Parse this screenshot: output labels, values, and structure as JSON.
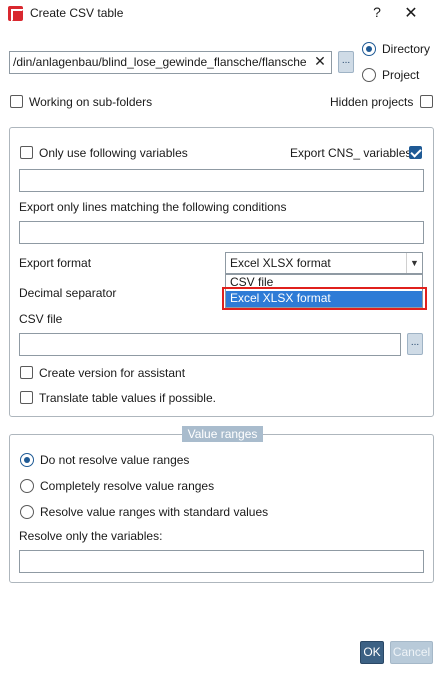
{
  "window": {
    "title": "Create CSV table",
    "help_label": "?",
    "close_label": "✕",
    "app_icon": "app-logo-icon"
  },
  "path_row": {
    "path_value": "/din/anlagenbau/blind_lose_gewinde_flansche/flansche",
    "clear_label": "✕",
    "browse_label": "...",
    "scope_options": [
      {
        "label": "Directory",
        "selected": true
      },
      {
        "label": "Project",
        "selected": false
      }
    ]
  },
  "options_top": {
    "working_on_subfolders": {
      "label": "Working on sub-folders",
      "checked": false
    },
    "hidden_projects": {
      "label": "Hidden projects",
      "checked": false
    }
  },
  "export_group": {
    "only_following_variables": {
      "label": "Only use following variables",
      "checked": false,
      "value": ""
    },
    "export_cns_variables": {
      "label": "Export CNS_ variables",
      "checked": true
    },
    "conditions_label": "Export only lines matching the following conditions",
    "conditions_value": "",
    "export_format_label": "Export format",
    "export_format_value": "Excel XLSX format",
    "export_format_options": [
      "CSV file",
      "Excel XLSX format"
    ],
    "export_format_highlighted": "Excel XLSX format",
    "decimal_separator_label": "Decimal separator",
    "csv_file_label": "CSV file",
    "csv_file_value": "",
    "csv_browse_label": "...",
    "create_version": {
      "label": "Create version for assistant",
      "checked": false
    },
    "translate_values": {
      "label": "Translate table values if possible.",
      "checked": false
    }
  },
  "value_ranges": {
    "legend": "Value ranges",
    "options": [
      {
        "label": "Do not resolve value ranges",
        "selected": true
      },
      {
        "label": "Completely resolve value ranges",
        "selected": false
      },
      {
        "label": "Resolve value ranges with standard values",
        "selected": false
      }
    ],
    "resolve_only_label": "Resolve only the variables:",
    "resolve_only_value": ""
  },
  "buttons": {
    "ok_label": "OK",
    "cancel_label": "Cancel"
  },
  "colors": {
    "accent": "#1f5a95",
    "selection": "#2e7bd6",
    "highlight_border": "#e0201c",
    "ok_button": "#3c6184",
    "cancel_button_disabled": "#b8cad9"
  }
}
